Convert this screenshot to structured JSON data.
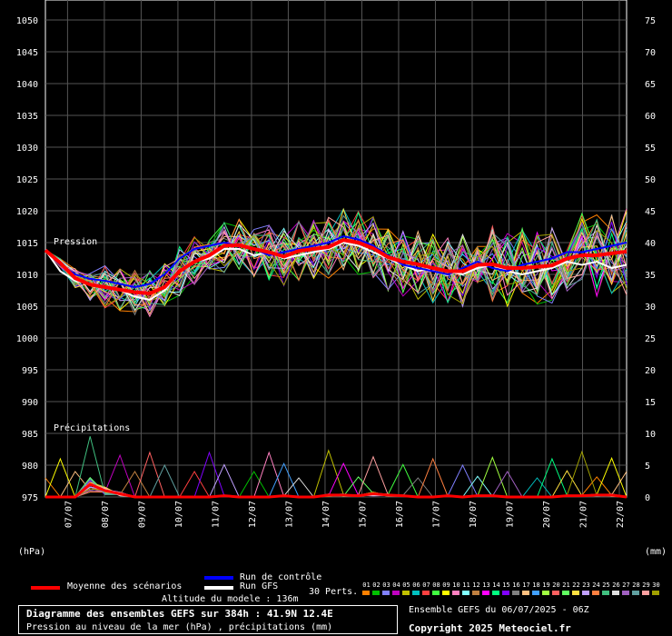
{
  "chart_data": {
    "type": "line",
    "title": "Diagramme des ensembles GEFS sur 384h : 41.9N 12.4E",
    "subtitle": "Pression au niveau de la mer (hPa) , précipitations (mm)",
    "left_axis_unit": "(hPa)",
    "right_axis_unit": "(mm)",
    "left_ylim": [
      975,
      1050
    ],
    "right_ylim": [
      0,
      75
    ],
    "left_ticks": [
      1050,
      1045,
      1040,
      1035,
      1030,
      1025,
      1020,
      1015,
      1010,
      1005,
      1000,
      995,
      990,
      985,
      980,
      975
    ],
    "right_ticks": [
      75,
      70,
      65,
      60,
      55,
      50,
      45,
      40,
      35,
      30,
      25,
      20,
      15,
      10,
      5,
      0
    ],
    "x_ticks": [
      "07/07",
      "08/07",
      "09/07",
      "10/07",
      "11/07",
      "12/07",
      "13/07",
      "14/07",
      "15/07",
      "16/07",
      "17/07",
      "18/07",
      "19/07",
      "20/07",
      "21/07",
      "22/07"
    ],
    "pressure_label": "Pression",
    "precip_label": "Précipitations",
    "grid": true,
    "series": [
      {
        "name": "Moyenne des scénarios",
        "color": "#ff0000",
        "values": [
          1013.8,
          1011.8,
          1009.4,
          1008.4,
          1008.0,
          1007.6,
          1007.2,
          1007.0,
          1008.0,
          1010.5,
          1012.0,
          1013.0,
          1014.5,
          1014.6,
          1014.0,
          1013.5,
          1012.8,
          1013.7,
          1014.0,
          1014.3,
          1015.4,
          1015.0,
          1014.1,
          1012.7,
          1012.0,
          1011.6,
          1011.0,
          1010.5,
          1010.5,
          1011.5,
          1011.6,
          1011.0,
          1011.0,
          1011.2,
          1011.4,
          1012.5,
          1013.0,
          1013.0,
          1013.3,
          1013.6
        ]
      },
      {
        "name": "Run de contrôle",
        "color": "#0000ff",
        "values": [
          1013.8,
          1011.5,
          1010.0,
          1009.3,
          1009.0,
          1008.5,
          1008.0,
          1008.5,
          1010.0,
          1012.5,
          1014.0,
          1014.5,
          1015.0,
          1014.5,
          1014.0,
          1013.0,
          1013.5,
          1014.0,
          1014.5,
          1015.0,
          1016.0,
          1015.5,
          1014.5,
          1013.0,
          1011.5,
          1011.0,
          1010.5,
          1010.0,
          1011.0,
          1012.0,
          1011.0,
          1010.5,
          1011.5,
          1012.0,
          1012.5,
          1013.5,
          1013.5,
          1014.0,
          1014.5,
          1015.0
        ]
      },
      {
        "name": "Run GFS",
        "color": "#ffffff",
        "values": [
          1013.8,
          1010.5,
          1009.0,
          1008.5,
          1008.0,
          1007.5,
          1006.5,
          1006.0,
          1007.5,
          1010.5,
          1012.0,
          1012.5,
          1014.0,
          1014.0,
          1013.0,
          1013.5,
          1012.5,
          1013.0,
          1013.5,
          1014.0,
          1015.0,
          1014.5,
          1013.5,
          1012.5,
          1011.5,
          1010.5,
          1011.0,
          1010.5,
          1010.0,
          1011.0,
          1011.5,
          1010.5,
          1010.0,
          1010.5,
          1011.0,
          1012.0,
          1011.5,
          1012.0,
          1011.0,
          1011.5
        ]
      }
    ],
    "precip_mean": [
      0,
      0,
      0,
      2.0,
      1.0,
      0.5,
      0,
      0,
      0,
      0,
      0,
      0,
      0.2,
      0,
      0,
      0,
      0.2,
      0,
      0,
      0.3,
      0.3,
      0.2,
      0.5,
      0.3,
      0.2,
      0,
      0,
      0.2,
      0,
      0.2,
      0.2,
      0,
      0,
      0,
      0,
      0.2,
      0.2,
      0.3,
      0.3,
      0
    ]
  },
  "legend": {
    "mean_label": "Moyenne des scénarios",
    "control_label": "Run de contrôle",
    "gfs_label": "Run GFS",
    "perts_label": "30 Perts.",
    "pert_numbers": [
      "01",
      "02",
      "03",
      "04",
      "05",
      "06",
      "07",
      "08",
      "09",
      "10",
      "11",
      "12",
      "13",
      "14",
      "15",
      "16",
      "17",
      "18",
      "19",
      "20",
      "21",
      "22",
      "23",
      "24",
      "25",
      "26",
      "27",
      "28",
      "29",
      "30"
    ],
    "pert_colors": [
      "#ff8000",
      "#00c000",
      "#8080ff",
      "#c000c0",
      "#c0c000",
      "#00c0c0",
      "#ff4040",
      "#40ff40",
      "#ffff00",
      "#ff80c0",
      "#80ffff",
      "#c08040",
      "#ff00ff",
      "#00ff80",
      "#8000ff",
      "#808080",
      "#ffc080",
      "#40a0ff",
      "#a0ff40",
      "#ff6060",
      "#60ff60",
      "#ffe040",
      "#c0a0ff",
      "#ff8040",
      "#40c080",
      "#e0e0e0",
      "#a060c0",
      "#60a0a0",
      "#ffa0a0",
      "#a0a000"
    ],
    "colors": {
      "mean": "#ff0000",
      "control": "#0000ff",
      "gfs": "#ffffff"
    }
  },
  "altitude": "Altitude du modele : 136m",
  "footer": {
    "title": "Diagramme des ensembles GEFS sur 384h : 41.9N 12.4E",
    "subtitle": "Pression au niveau de la mer (hPa) , précipitations (mm)",
    "ensemble_info": "Ensemble GEFS du 06/07/2025 - 06Z",
    "copyright": "Copyright 2025 Meteociel.fr"
  }
}
